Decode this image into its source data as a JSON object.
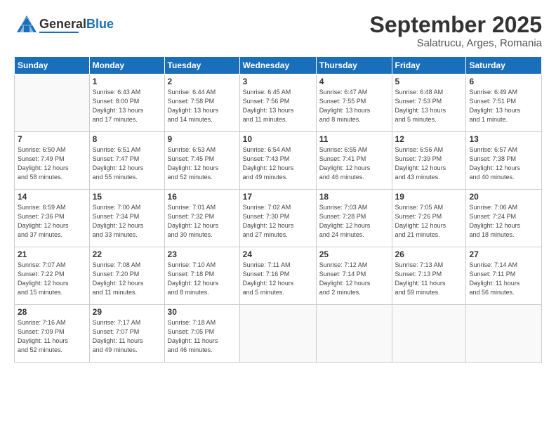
{
  "header": {
    "logo_general": "General",
    "logo_blue": "Blue",
    "month_title": "September 2025",
    "location": "Salatrucu, Arges, Romania"
  },
  "weekdays": [
    "Sunday",
    "Monday",
    "Tuesday",
    "Wednesday",
    "Thursday",
    "Friday",
    "Saturday"
  ],
  "weeks": [
    [
      {
        "day": "",
        "info": ""
      },
      {
        "day": "1",
        "info": "Sunrise: 6:43 AM\nSunset: 8:00 PM\nDaylight: 13 hours\nand 17 minutes."
      },
      {
        "day": "2",
        "info": "Sunrise: 6:44 AM\nSunset: 7:58 PM\nDaylight: 13 hours\nand 14 minutes."
      },
      {
        "day": "3",
        "info": "Sunrise: 6:45 AM\nSunset: 7:56 PM\nDaylight: 13 hours\nand 11 minutes."
      },
      {
        "day": "4",
        "info": "Sunrise: 6:47 AM\nSunset: 7:55 PM\nDaylight: 13 hours\nand 8 minutes."
      },
      {
        "day": "5",
        "info": "Sunrise: 6:48 AM\nSunset: 7:53 PM\nDaylight: 13 hours\nand 5 minutes."
      },
      {
        "day": "6",
        "info": "Sunrise: 6:49 AM\nSunset: 7:51 PM\nDaylight: 13 hours\nand 1 minute."
      }
    ],
    [
      {
        "day": "7",
        "info": "Sunrise: 6:50 AM\nSunset: 7:49 PM\nDaylight: 12 hours\nand 58 minutes."
      },
      {
        "day": "8",
        "info": "Sunrise: 6:51 AM\nSunset: 7:47 PM\nDaylight: 12 hours\nand 55 minutes."
      },
      {
        "day": "9",
        "info": "Sunrise: 6:53 AM\nSunset: 7:45 PM\nDaylight: 12 hours\nand 52 minutes."
      },
      {
        "day": "10",
        "info": "Sunrise: 6:54 AM\nSunset: 7:43 PM\nDaylight: 12 hours\nand 49 minutes."
      },
      {
        "day": "11",
        "info": "Sunrise: 6:55 AM\nSunset: 7:41 PM\nDaylight: 12 hours\nand 46 minutes."
      },
      {
        "day": "12",
        "info": "Sunrise: 6:56 AM\nSunset: 7:39 PM\nDaylight: 12 hours\nand 43 minutes."
      },
      {
        "day": "13",
        "info": "Sunrise: 6:57 AM\nSunset: 7:38 PM\nDaylight: 12 hours\nand 40 minutes."
      }
    ],
    [
      {
        "day": "14",
        "info": "Sunrise: 6:59 AM\nSunset: 7:36 PM\nDaylight: 12 hours\nand 37 minutes."
      },
      {
        "day": "15",
        "info": "Sunrise: 7:00 AM\nSunset: 7:34 PM\nDaylight: 12 hours\nand 33 minutes."
      },
      {
        "day": "16",
        "info": "Sunrise: 7:01 AM\nSunset: 7:32 PM\nDaylight: 12 hours\nand 30 minutes."
      },
      {
        "day": "17",
        "info": "Sunrise: 7:02 AM\nSunset: 7:30 PM\nDaylight: 12 hours\nand 27 minutes."
      },
      {
        "day": "18",
        "info": "Sunrise: 7:03 AM\nSunset: 7:28 PM\nDaylight: 12 hours\nand 24 minutes."
      },
      {
        "day": "19",
        "info": "Sunrise: 7:05 AM\nSunset: 7:26 PM\nDaylight: 12 hours\nand 21 minutes."
      },
      {
        "day": "20",
        "info": "Sunrise: 7:06 AM\nSunset: 7:24 PM\nDaylight: 12 hours\nand 18 minutes."
      }
    ],
    [
      {
        "day": "21",
        "info": "Sunrise: 7:07 AM\nSunset: 7:22 PM\nDaylight: 12 hours\nand 15 minutes."
      },
      {
        "day": "22",
        "info": "Sunrise: 7:08 AM\nSunset: 7:20 PM\nDaylight: 12 hours\nand 11 minutes."
      },
      {
        "day": "23",
        "info": "Sunrise: 7:10 AM\nSunset: 7:18 PM\nDaylight: 12 hours\nand 8 minutes."
      },
      {
        "day": "24",
        "info": "Sunrise: 7:11 AM\nSunset: 7:16 PM\nDaylight: 12 hours\nand 5 minutes."
      },
      {
        "day": "25",
        "info": "Sunrise: 7:12 AM\nSunset: 7:14 PM\nDaylight: 12 hours\nand 2 minutes."
      },
      {
        "day": "26",
        "info": "Sunrise: 7:13 AM\nSunset: 7:13 PM\nDaylight: 11 hours\nand 59 minutes."
      },
      {
        "day": "27",
        "info": "Sunrise: 7:14 AM\nSunset: 7:11 PM\nDaylight: 11 hours\nand 56 minutes."
      }
    ],
    [
      {
        "day": "28",
        "info": "Sunrise: 7:16 AM\nSunset: 7:09 PM\nDaylight: 11 hours\nand 52 minutes."
      },
      {
        "day": "29",
        "info": "Sunrise: 7:17 AM\nSunset: 7:07 PM\nDaylight: 11 hours\nand 49 minutes."
      },
      {
        "day": "30",
        "info": "Sunrise: 7:18 AM\nSunset: 7:05 PM\nDaylight: 11 hours\nand 46 minutes."
      },
      {
        "day": "",
        "info": ""
      },
      {
        "day": "",
        "info": ""
      },
      {
        "day": "",
        "info": ""
      },
      {
        "day": "",
        "info": ""
      }
    ]
  ]
}
